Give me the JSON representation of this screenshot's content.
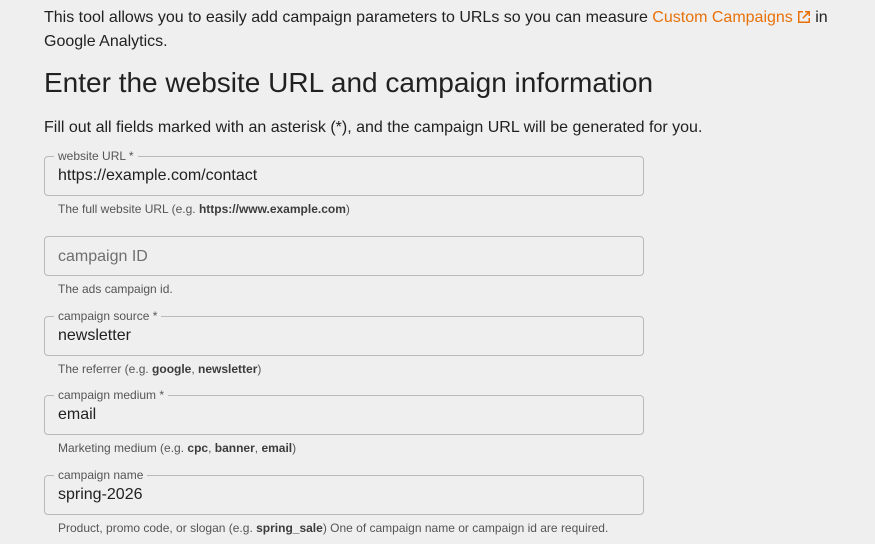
{
  "intro": {
    "text_before": "This tool allows you to easily add campaign parameters to URLs so you can measure ",
    "link_label": "Custom Campaigns",
    "text_after": " in Google Analytics."
  },
  "heading": "Enter the website URL and campaign information",
  "subtext": "Fill out all fields marked with an asterisk (*), and the campaign URL will be generated for you.",
  "accent_color": "#e8710a",
  "fields": [
    {
      "label": "website URL *",
      "value": "https://example.com/contact",
      "placeholder": "",
      "help_prefix": "The full website URL (e.g. ",
      "help_ex1": "https://www.example.com",
      "help_suffix": ")"
    },
    {
      "label": "",
      "value": "",
      "placeholder": "campaign ID",
      "help": "The ads campaign id."
    },
    {
      "label": "campaign source *",
      "value": "newsletter",
      "placeholder": "",
      "help_prefix": "The referrer (e.g. ",
      "help_ex1": "google",
      "help_sep": ", ",
      "help_ex2": "newsletter",
      "help_suffix": ")"
    },
    {
      "label": "campaign medium *",
      "value": "email",
      "placeholder": "",
      "help_prefix": "Marketing medium (e.g. ",
      "help_ex1": "cpc",
      "help_sep1": ", ",
      "help_ex2": "banner",
      "help_sep2": ", ",
      "help_ex3": "email",
      "help_suffix": ")"
    },
    {
      "label": "campaign name",
      "value": "spring-2026",
      "placeholder": "",
      "help_prefix": "Product, promo code, or slogan (e.g. ",
      "help_ex1": "spring_sale",
      "help_suffix": ") One of campaign name or campaign id are required."
    }
  ]
}
